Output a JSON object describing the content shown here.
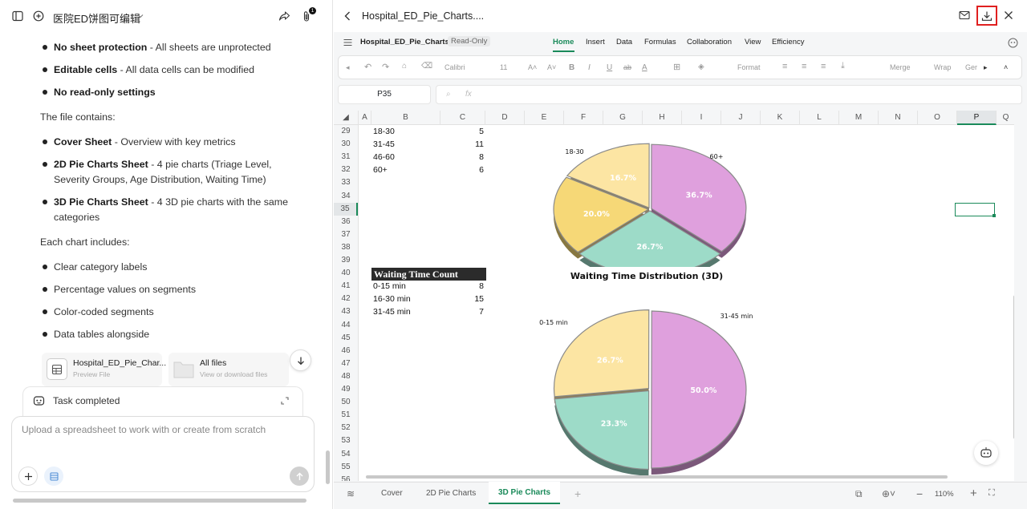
{
  "left": {
    "title": "医院ED饼图可编辑",
    "bullets1": [
      {
        "bold": "No sheet protection",
        "rest": " - All sheets are unprotected"
      },
      {
        "bold": "Editable cells",
        "rest": " - All data cells can be modified"
      },
      {
        "bold": "No read-only settings",
        "rest": ""
      }
    ],
    "contains_text": "The file contains:",
    "bullets2": [
      {
        "bold": "Cover Sheet",
        "rest": " - Overview with key metrics"
      },
      {
        "bold": "2D Pie Charts Sheet",
        "rest": " - 4 pie charts (Triage Level, Severity Groups, Age Distribution, Waiting Time)"
      },
      {
        "bold": "3D Pie Charts Sheet",
        "rest": " - 4 3D pie charts with the same categories"
      }
    ],
    "includes_text": "Each chart includes:",
    "bullets3": [
      "Clear category labels",
      "Percentage values on segments",
      "Color-coded segments",
      "Data tables alongside"
    ],
    "file_card": {
      "name": "Hospital_ED_Pie_Char...",
      "sub": "Preview File"
    },
    "files_card": {
      "name": "All files",
      "sub": "View or download files"
    },
    "task_status": "Task completed",
    "input_placeholder": "Upload a spreadsheet to work with or create from scratch"
  },
  "right": {
    "doc_title": "Hospital_ED_Pie_Charts....",
    "file_label": "Hospital_ED_Pie_Charts",
    "readonly_badge": "Read-Only",
    "menu_tabs": [
      "Home",
      "Insert",
      "Data",
      "Formulas",
      "Collaboration",
      "View",
      "Efficiency"
    ],
    "active_menu": "Home",
    "toolbar": {
      "font": "Calibri",
      "size": "11",
      "format": "Format",
      "merge": "Merge",
      "wrap": "Wrap",
      "general": "Ger"
    },
    "name_box": "P35",
    "fx": "fx",
    "columns": [
      "A",
      "B",
      "C",
      "D",
      "E",
      "F",
      "G",
      "H",
      "I",
      "J",
      "K",
      "L",
      "M",
      "N",
      "O",
      "P",
      "Q"
    ],
    "rows": [
      "29",
      "30",
      "31",
      "32",
      "33",
      "34",
      "35",
      "36",
      "37",
      "38",
      "39",
      "40",
      "41",
      "42",
      "43",
      "44",
      "45",
      "46",
      "47",
      "48",
      "49",
      "50",
      "51",
      "52",
      "53",
      "54",
      "55",
      "56"
    ],
    "age_rows": [
      [
        "18-30",
        "5"
      ],
      [
        "31-45",
        "11"
      ],
      [
        "46-60",
        "8"
      ],
      [
        "60+",
        "6"
      ]
    ],
    "wait_header": "Waiting Time Count",
    "wait_rows": [
      [
        "0-15 min",
        "8"
      ],
      [
        "16-30 min",
        "15"
      ],
      [
        "31-45 min",
        "7"
      ]
    ],
    "sheet_tabs": [
      "Cover",
      "2D Pie Charts",
      "3D Pie Charts"
    ],
    "active_sheet": "3D Pie Charts",
    "zoom": "110%"
  },
  "chart_data": [
    {
      "type": "pie",
      "title": "",
      "categories": [
        "18-30",
        "31-45",
        "46-60",
        "60+"
      ],
      "values": [
        16.7,
        36.7,
        26.7,
        20.0
      ],
      "labels": [
        "16.7%",
        "36.7%",
        "26.7%",
        "20.0%"
      ],
      "colors": [
        "#fce5a3",
        "#dfa0dd",
        "#9ddbc8",
        "#f6d877"
      ]
    },
    {
      "type": "pie",
      "title": "Waiting Time Distribution (3D)",
      "categories": [
        "0-15 min",
        "16-30 min",
        "31-45 min"
      ],
      "values": [
        26.7,
        50.0,
        23.3
      ],
      "labels": [
        "26.7%",
        "50.0%",
        "23.3%"
      ],
      "colors": [
        "#fce5a3",
        "#dfa0dd",
        "#9ddbc8"
      ]
    }
  ],
  "colors": {
    "accent": "#1a8a5a",
    "highlight_border": "#e02020"
  }
}
